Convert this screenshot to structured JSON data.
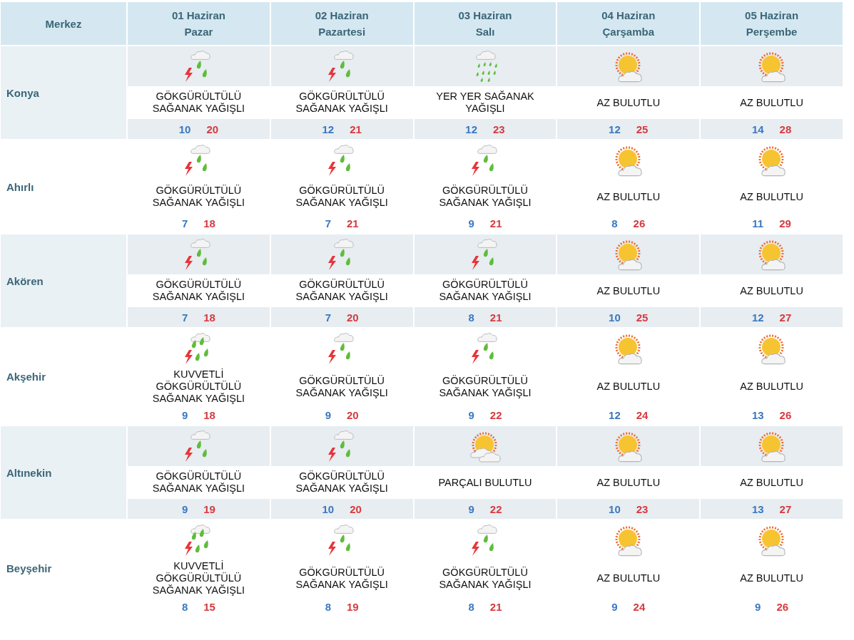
{
  "header": {
    "corner": "Merkez",
    "days": [
      {
        "date": "01 Haziran",
        "weekday": "Pazar"
      },
      {
        "date": "02 Haziran",
        "weekday": "Pazartesi"
      },
      {
        "date": "03 Haziran",
        "weekday": "Salı"
      },
      {
        "date": "04 Haziran",
        "weekday": "Çarşamba"
      },
      {
        "date": "05 Haziran",
        "weekday": "Perşembe"
      }
    ]
  },
  "cities": [
    {
      "name": "Konya",
      "days": [
        {
          "kind": "thunder-shower",
          "text": "GÖKGÜRÜLTÜLÜ SAĞANAK YAĞIŞLI",
          "min": "10",
          "max": "20"
        },
        {
          "kind": "thunder-shower",
          "text": "GÖKGÜRÜLTÜLÜ SAĞANAK YAĞIŞLI",
          "min": "12",
          "max": "21"
        },
        {
          "kind": "showers",
          "text": "YER YER SAĞANAK YAĞIŞLI",
          "min": "12",
          "max": "23"
        },
        {
          "kind": "few-clouds",
          "text": "AZ BULUTLU",
          "min": "12",
          "max": "25"
        },
        {
          "kind": "few-clouds",
          "text": "AZ BULUTLU",
          "min": "14",
          "max": "28"
        }
      ]
    },
    {
      "name": "Ahırlı",
      "days": [
        {
          "kind": "thunder-shower",
          "text": "GÖKGÜRÜLTÜLÜ SAĞANAK YAĞIŞLI",
          "min": "7",
          "max": "18"
        },
        {
          "kind": "thunder-shower",
          "text": "GÖKGÜRÜLTÜLÜ SAĞANAK YAĞIŞLI",
          "min": "7",
          "max": "21"
        },
        {
          "kind": "thunder-shower",
          "text": "GÖKGÜRÜLTÜLÜ SAĞANAK YAĞIŞLI",
          "min": "9",
          "max": "21"
        },
        {
          "kind": "few-clouds",
          "text": "AZ BULUTLU",
          "min": "8",
          "max": "26"
        },
        {
          "kind": "few-clouds",
          "text": "AZ BULUTLU",
          "min": "11",
          "max": "29"
        }
      ]
    },
    {
      "name": "Akören",
      "days": [
        {
          "kind": "thunder-shower",
          "text": "GÖKGÜRÜLTÜLÜ SAĞANAK YAĞIŞLI",
          "min": "7",
          "max": "18"
        },
        {
          "kind": "thunder-shower",
          "text": "GÖKGÜRÜLTÜLÜ SAĞANAK YAĞIŞLI",
          "min": "7",
          "max": "20"
        },
        {
          "kind": "thunder-shower",
          "text": "GÖKGÜRÜLTÜLÜ SAĞANAK YAĞIŞLI",
          "min": "8",
          "max": "21"
        },
        {
          "kind": "few-clouds",
          "text": "AZ BULUTLU",
          "min": "10",
          "max": "25"
        },
        {
          "kind": "few-clouds",
          "text": "AZ BULUTLU",
          "min": "12",
          "max": "27"
        }
      ]
    },
    {
      "name": "Akşehir",
      "days": [
        {
          "kind": "heavy-thunder-shower",
          "text": "KUVVETLİ GÖKGÜRÜLTÜLÜ SAĞANAK YAĞIŞLI",
          "min": "9",
          "max": "18"
        },
        {
          "kind": "thunder-shower",
          "text": "GÖKGÜRÜLTÜLÜ SAĞANAK YAĞIŞLI",
          "min": "9",
          "max": "20"
        },
        {
          "kind": "thunder-shower",
          "text": "GÖKGÜRÜLTÜLÜ SAĞANAK YAĞIŞLI",
          "min": "9",
          "max": "22"
        },
        {
          "kind": "few-clouds",
          "text": "AZ BULUTLU",
          "min": "12",
          "max": "24"
        },
        {
          "kind": "few-clouds",
          "text": "AZ BULUTLU",
          "min": "13",
          "max": "26"
        }
      ]
    },
    {
      "name": "Altınekin",
      "days": [
        {
          "kind": "thunder-shower",
          "text": "GÖKGÜRÜLTÜLÜ SAĞANAK YAĞIŞLI",
          "min": "9",
          "max": "19"
        },
        {
          "kind": "thunder-shower",
          "text": "GÖKGÜRÜLTÜLÜ SAĞANAK YAĞIŞLI",
          "min": "10",
          "max": "20"
        },
        {
          "kind": "partly-cloudy",
          "text": "PARÇALI BULUTLU",
          "min": "9",
          "max": "22"
        },
        {
          "kind": "few-clouds",
          "text": "AZ BULUTLU",
          "min": "10",
          "max": "23"
        },
        {
          "kind": "few-clouds",
          "text": "AZ BULUTLU",
          "min": "13",
          "max": "27"
        }
      ]
    },
    {
      "name": "Beyşehir",
      "days": [
        {
          "kind": "heavy-thunder-shower",
          "text": "KUVVETLİ GÖKGÜRÜLTÜLÜ SAĞANAK YAĞIŞLI",
          "min": "8",
          "max": "15"
        },
        {
          "kind": "thunder-shower",
          "text": "GÖKGÜRÜLTÜLÜ SAĞANAK YAĞIŞLI",
          "min": "8",
          "max": "19"
        },
        {
          "kind": "thunder-shower",
          "text": "GÖKGÜRÜLTÜLÜ SAĞANAK YAĞIŞLI",
          "min": "8",
          "max": "21"
        },
        {
          "kind": "few-clouds",
          "text": "AZ BULUTLU",
          "min": "9",
          "max": "24"
        },
        {
          "kind": "few-clouds",
          "text": "AZ BULUTLU",
          "min": "9",
          "max": "26"
        }
      ]
    }
  ]
}
